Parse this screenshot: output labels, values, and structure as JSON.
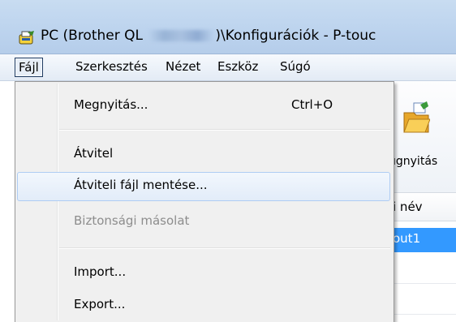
{
  "window": {
    "title_prefix": "PC (Brother QL ",
    "title_suffix": ")\\Konfigurációk - P-touc"
  },
  "menubar": {
    "items": [
      {
        "label": "Fájl"
      },
      {
        "label": "Szerkesztés"
      },
      {
        "label": "Nézet"
      },
      {
        "label": "Eszköz"
      },
      {
        "label": "Súgó"
      }
    ]
  },
  "toolbar": {
    "open_label": "ıgnyitás"
  },
  "list": {
    "column_header": "i név",
    "selected_row": "out1"
  },
  "file_menu": {
    "items": [
      {
        "label": "Megnyitás...",
        "shortcut": "Ctrl+O"
      },
      {
        "label": "Átvitel"
      },
      {
        "label": "Átviteli fájl mentése..."
      },
      {
        "label": "Biztonsági másolat"
      },
      {
        "label": "Import..."
      },
      {
        "label": "Export..."
      }
    ]
  },
  "colors": {
    "selection": "#3399ff",
    "menu_bg": "#f0f0f0"
  }
}
